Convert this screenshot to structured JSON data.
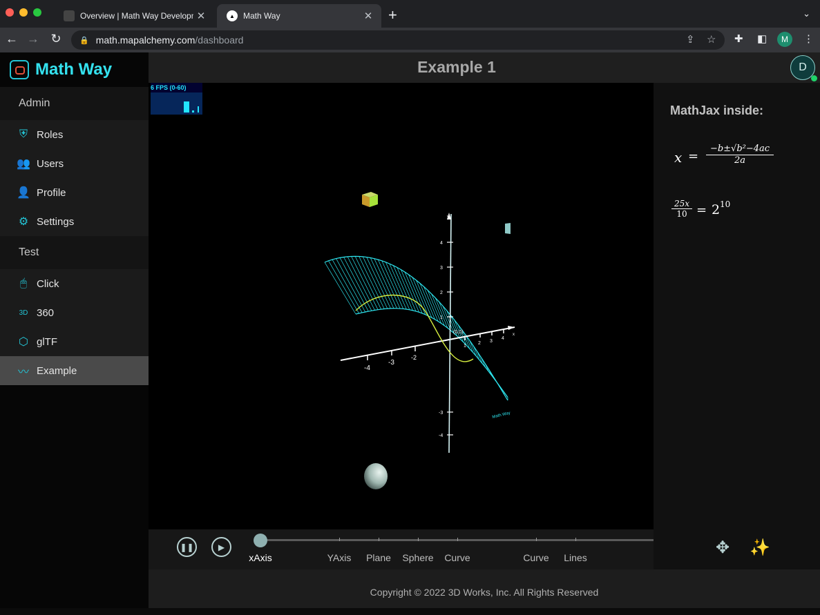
{
  "browser": {
    "tabs": [
      {
        "title": "Overview | Math Way Developm",
        "active": false
      },
      {
        "title": "Math Way",
        "active": true
      }
    ],
    "url_host": "math.mapalchemy.com",
    "url_path": "/dashboard",
    "profile_initial": "M"
  },
  "app": {
    "brand": "Math Way",
    "page_title": "Example 1",
    "avatar_initial": "D",
    "sections": [
      {
        "title": "Admin",
        "items": [
          {
            "label": "Roles",
            "icon": "shield-icon"
          },
          {
            "label": "Users",
            "icon": "users-icon"
          },
          {
            "label": "Profile",
            "icon": "person-icon"
          },
          {
            "label": "Settings",
            "icon": "gear-icon"
          }
        ]
      },
      {
        "title": "Test",
        "items": [
          {
            "label": "Click",
            "icon": "mouse-icon"
          },
          {
            "label": "360",
            "icon": "rotate-3d-icon"
          },
          {
            "label": "glTF",
            "icon": "cube-scan-icon"
          },
          {
            "label": "Example",
            "icon": "trend-line-icon",
            "active": true
          }
        ]
      }
    ]
  },
  "viewport": {
    "fps_label": "6 FPS (0-60)",
    "axis_labels": {
      "x_ticks": [
        "-4",
        "-3",
        "-2",
        "1",
        "2",
        "3",
        "4"
      ],
      "y_ticks": [
        "4",
        "3",
        "2",
        "1",
        "-3",
        "-4"
      ],
      "origin": "(0,0)",
      "y_axis": "y",
      "x_axis": "x",
      "watermark": "Math Way"
    }
  },
  "side_panel": {
    "title": "MathJax inside:",
    "formula1": {
      "lhs": "x",
      "eq": "=",
      "num": "−b±√b²−4ac",
      "den": "2a"
    },
    "formula2": {
      "num": "25x",
      "den": "10",
      "eq": "=",
      "base": "2",
      "exp": "10"
    }
  },
  "controls": {
    "marks": [
      "xAxis",
      "YAxis",
      "Plane",
      "Sphere",
      "Curve",
      "Curve",
      "Lines"
    ],
    "active_mark": "xAxis",
    "progress": 0
  },
  "footer": {
    "text": "Copyright © 2022 3D Works, Inc. All Rights Reserved"
  },
  "colors": {
    "accent": "#34e2ef",
    "wireframe": "#2ee6f0",
    "curve": "#d8f040"
  }
}
